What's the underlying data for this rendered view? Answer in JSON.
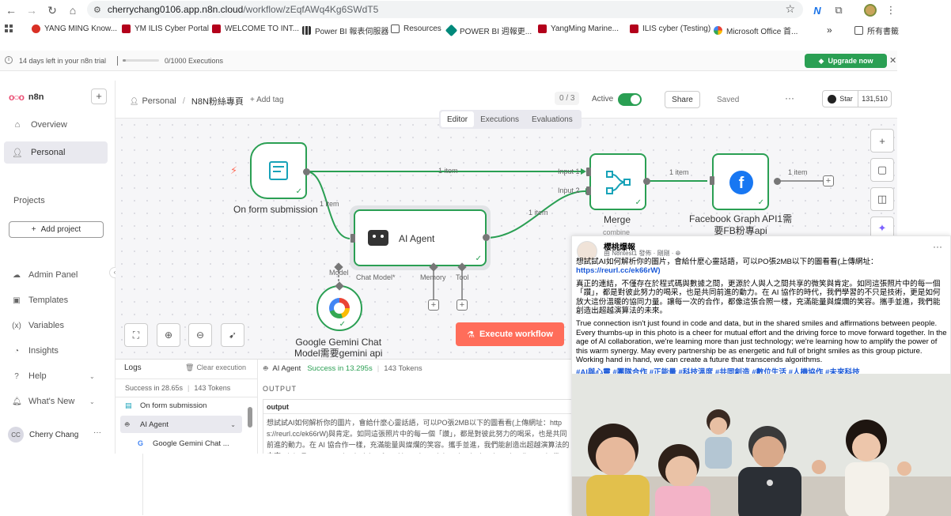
{
  "browser": {
    "host": "cherrychang0106.app.n8n.cloud",
    "path": "/workflow/zEqfAWq4Kg6SWdT5"
  },
  "bookmarks": [
    {
      "label": "YANG MING Know...",
      "color": "#d93025"
    },
    {
      "label": "YM ILIS Cyber Portal",
      "color": "#b3001b"
    },
    {
      "label": "WELCOME TO INT...",
      "color": "#b3001b"
    },
    {
      "label": "Power BI 報表伺服器",
      "color": "#333333"
    },
    {
      "label": "Resources",
      "color": "#555555"
    },
    {
      "label": "POWER BI 週報更...",
      "color": "#00897b"
    },
    {
      "label": "YangMing Marine...",
      "color": "#b3001b"
    },
    {
      "label": "ILIS cyber (Testing)",
      "color": "#b3001b"
    },
    {
      "label": "Microsoft Office 首...",
      "color": "#e06c00"
    }
  ],
  "bookmarks_more": "»",
  "bookmarks_folder": "所有書籤",
  "trial": {
    "days": "14 days left in your n8n trial",
    "executions": "0/1000 Executions",
    "executions_used_fraction": 0.0,
    "upgrade": "Upgrade now"
  },
  "sidebar": {
    "brand": "n8n",
    "nav": [
      {
        "label": "Overview",
        "icon": "home-icon"
      },
      {
        "label": "Personal",
        "icon": "user-icon"
      }
    ],
    "projects_heading": "Projects",
    "add_project": "Add project",
    "lower": [
      {
        "label": "Admin Panel",
        "icon": "cloud-icon"
      },
      {
        "label": "Templates",
        "icon": "box-icon"
      },
      {
        "label": "Variables",
        "icon": "variables-icon"
      },
      {
        "label": "Insights",
        "icon": "chart-icon"
      },
      {
        "label": "Help",
        "icon": "help-icon"
      },
      {
        "label": "What's New",
        "icon": "bell-icon"
      }
    ],
    "user": {
      "initials": "CC",
      "name": "Cherry Chang"
    }
  },
  "header": {
    "crumb_owner": "Personal",
    "crumb_title": "N8N粉絲專頁",
    "add_tag": "+ Add tag",
    "count": "0 / 3",
    "active_label": "Active",
    "share": "Share",
    "saved": "Saved",
    "github_star": "Star",
    "github_count": "131,510"
  },
  "tabs": [
    "Editor",
    "Executions",
    "Evaluations"
  ],
  "nodes": {
    "form": "On form submission",
    "agent": "AI Agent",
    "merge": "Merge",
    "merge_sub": "combine",
    "fb_line1": "Facebook Graph API1需",
    "fb_line2": "要FB粉專api",
    "gemini_line1": "Google Gemini Chat",
    "gemini_line2": "Model需要gemini api"
  },
  "edges": {
    "items": "1 item",
    "input1": "Input 1",
    "input2": "Input 2",
    "model_tag": "Model",
    "chat_model": "Chat Model*",
    "memory": "Memory",
    "tool": "Tool"
  },
  "execute": "Execute workflow",
  "logs": {
    "title": "Logs",
    "clear": "Clear execution",
    "summary_time": "Success in 28.65s",
    "summary_tokens": "143 Tokens",
    "rows": [
      {
        "label": "On form submission",
        "icon": "form-icon"
      },
      {
        "label": "AI Agent",
        "icon": "robot-icon"
      },
      {
        "label": "Google Gemini Chat ...",
        "icon": "google-icon"
      }
    ],
    "detail_node": "AI Agent",
    "detail_status": "Success in 13.295s",
    "detail_tokens": "143 Tokens",
    "output_label": "OUTPUT",
    "output_field": "output",
    "output_text": "想試試AI如何解析你的圖片，會給什麼心靈話語，可以PO張2MB以下的圖看看(上傳網址：https://reurl.cc/ek66rW)與肯定。如同這張照片中的每一個「讚」，都是對彼此努力的喝采，也是共同前進的動力。在 AI 協合作一樣，充滿能量與燦爛的笑容。攜手並進，我們能創造出超越演算法的未來。\\n\\n True connection isn't just found in code and data, but in the shared smiles and affirmations between people. Every thumbs-up in this photo is a cheer for mutual effort and the driving force to move forward together."
  },
  "post": {
    "name": "櫻桃爆報",
    "meta": "由 N8ntest1 發佈 · 剛剛 · ",
    "line1": "想試試AI如何解析你的圖片，會給什麼心靈話語，可以PO張2MB以下的圖看看(上傳網址：",
    "link": "https://reurl.cc/ek66rW)",
    "zh": "真正的連結，不僅存在於程式碼與數據之間，更源於人與人之間共享的微笑與肯定。如同這張照片中的每一個「讚」，都是對彼此努力的喝采，也是共同前進的動力。在 AI 協作的時代，我們學習的不只是技術，更是如何放大這份溫暖的協同力量。讓每一次的合作，都像這張合照一樣，充滿能量與燦爛的笑容。攜手並進，我們能創造出超越演算法的未來。",
    "en": "True connection isn't just found in code and data, but in the shared smiles and affirmations between people. Every thumbs-up in this photo is a cheer for mutual effort and the driving force to move forward together. In the age of AI collaboration, we're learning more than just technology; we're learning how to amplify the power of this warm synergy. May every partnership be as energetic and full of bright smiles as this group picture. Working hand in hand, we can create a future that transcends algorithms.",
    "tags": "#AI與心靈 #團隊合作 #正能量 #科技溫度 #共同創造 #數位生活 #人機協作 #未來科技"
  }
}
